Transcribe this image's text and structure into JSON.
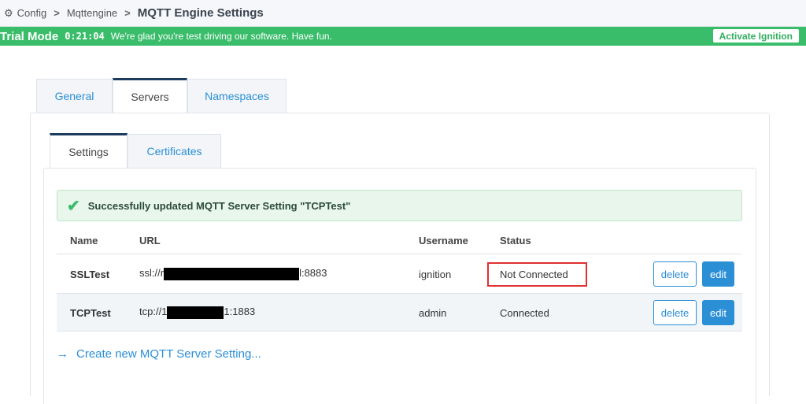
{
  "breadcrumb": {
    "items": [
      "Config",
      "Mqttengine"
    ],
    "current": "MQTT Engine Settings"
  },
  "trial": {
    "label": "Trial Mode",
    "clock": "0:21:04",
    "message": "We're glad you're test driving our software. Have fun.",
    "activate": "Activate Ignition"
  },
  "outer_tabs": [
    "General",
    "Servers",
    "Namespaces"
  ],
  "inner_tabs": [
    "Settings",
    "Certificates"
  ],
  "alert": "Successfully updated MQTT Server Setting \"TCPTest\"",
  "table": {
    "headers": [
      "Name",
      "URL",
      "Username",
      "Status"
    ],
    "rows": [
      {
        "name": "SSLTest",
        "url_prefix": "ssl://r",
        "url_suffix": "l:8883",
        "username": "ignition",
        "status": "Not Connected"
      },
      {
        "name": "TCPTest",
        "url_prefix": "tcp://1",
        "url_suffix": "1:1883",
        "username": "admin",
        "status": "Connected"
      }
    ],
    "delete_label": "delete",
    "edit_label": "edit"
  },
  "create_link": "Create new MQTT Server Setting...",
  "colors": {
    "trial": "#3abd6a",
    "link": "#2b8fd6",
    "highlight": "#e03030"
  }
}
